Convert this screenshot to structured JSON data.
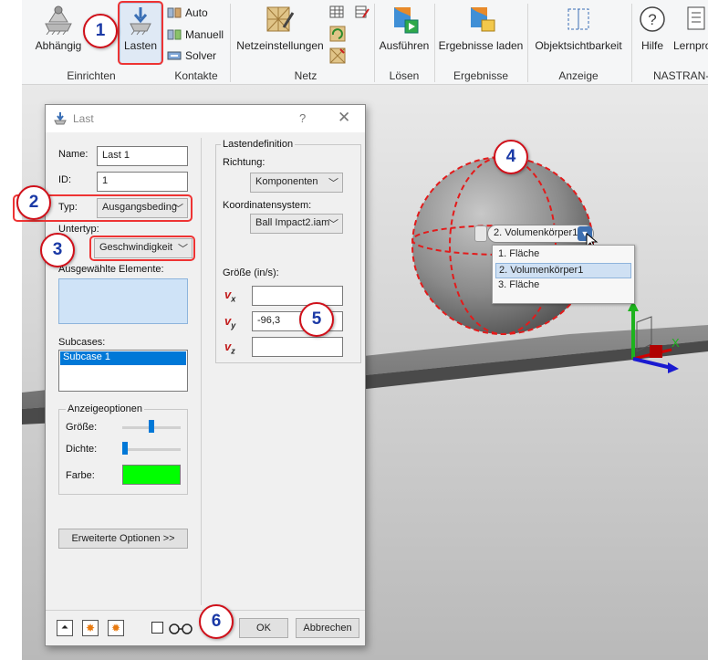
{
  "ribbon": {
    "abhaengig_label": "Abhängig",
    "lasten_label": "Lasten",
    "auto_label": "Auto",
    "manuell_label": "Manuell",
    "solver_label": "Solver",
    "netzeinstellungen_label": "Netzeinstellungen",
    "ausfuehren_label": "Ausführen",
    "ergebnisse_laden_label": "Ergebnisse laden",
    "objektsichtbarkeit_label": "Objektsichtbarkeit",
    "hilfe_label": "Hilfe",
    "lernpro_label": "Lernpro",
    "groups": {
      "einrichten": "Einrichten",
      "kontakte": "Kontakte",
      "netz": "Netz",
      "loesen": "Lösen",
      "ergebnisse": "Ergebnisse",
      "anzeige": "Anzeige",
      "nastran": "NASTRAN-"
    }
  },
  "dialog": {
    "title": "Last",
    "help": "?",
    "name_label": "Name:",
    "name_value": "Last 1",
    "id_label": "ID:",
    "id_value": "1",
    "typ_label": "Typ:",
    "typ_value": "Ausgangsbeding",
    "untertyp_label": "Untertyp:",
    "untertyp_value": "Geschwindigkeit",
    "ausgewaehlte_label": "Ausgewählte Elemente:",
    "subcases_label": "Subcases:",
    "subcases": [
      "Subcase 1"
    ],
    "anzeigeoptionen_label": "Anzeigeoptionen",
    "groesse_label": "Größe:",
    "dichte_label": "Dichte:",
    "farbe_label": "Farbe:",
    "farbe_color": "#00ff00",
    "groesse_slider": 0.5,
    "dichte_slider": 0.0,
    "erweiterte_button": "Erweiterte Optionen >>",
    "lastendefinition_label": "Lastendefinition",
    "richtung_label": "Richtung:",
    "richtung_value": "Komponenten",
    "koordinatensystem_label": "Koordinatensystem:",
    "koordinatensystem_value": "Ball Impact2.iam",
    "groesse_ins_label": "Größe (in/s):",
    "vx_label": "v",
    "vx_sub": "x",
    "vy_label": "v",
    "vy_sub": "y",
    "vz_label": "v",
    "vz_sub": "z",
    "vx_value": "",
    "vy_value": "-96,3",
    "vz_value": "",
    "ok_button": "OK",
    "abbrechen_button": "Abbrechen"
  },
  "selector": {
    "current": "2. Volumenkörper1",
    "options": [
      "1. Fläche",
      "2. Volumenkörper1",
      "3. Fläche"
    ],
    "selected_index": 1
  },
  "callouts": [
    "1",
    "2",
    "3",
    "4",
    "5",
    "6"
  ],
  "colors": {
    "accent_red": "#e33333",
    "callout_text": "#1b3aa6",
    "selection_blue": "#0078d7",
    "triad_y": "#1db31d",
    "triad_x": "#d00000",
    "triad_z": "#1a1ad0"
  }
}
